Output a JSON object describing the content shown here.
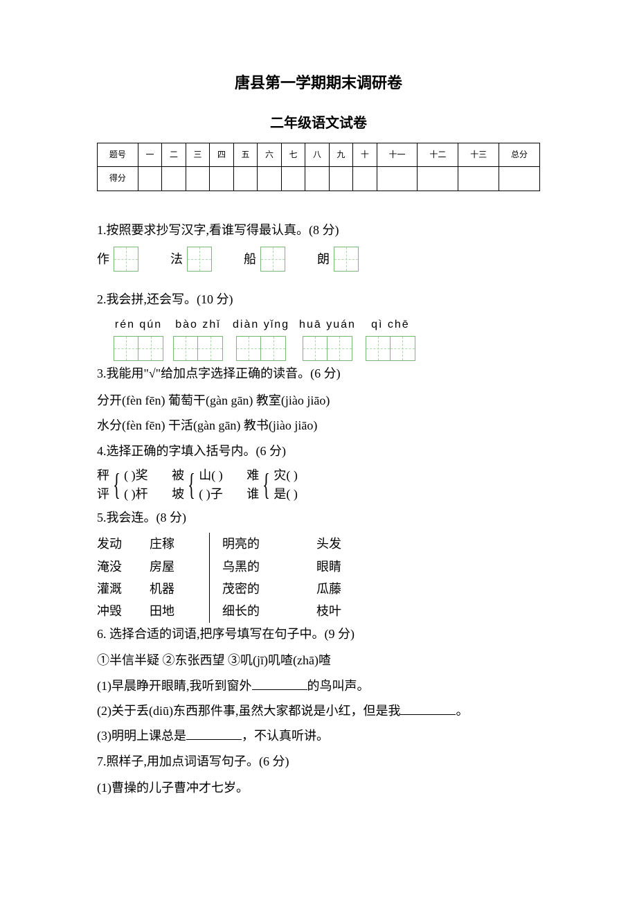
{
  "title_main": "唐县第一学期期末调研卷",
  "title_sub": "二年级语文试卷",
  "score_headers": [
    "题号",
    "一",
    "二",
    "三",
    "四",
    "五",
    "六",
    "七",
    "八",
    "九",
    "十",
    "十一",
    "十二",
    "十三",
    "总分"
  ],
  "score_row_label": "得分",
  "q1": {
    "text": "1.按照要求抄写汉字,看谁写得最认真。(8 分)",
    "chars": [
      "作",
      "法",
      "船",
      "朗"
    ]
  },
  "q2": {
    "text": "2.我会拼,还会写。(10  分)",
    "pinyin": [
      "rén    qún",
      "bào    zhǐ",
      "diàn    yǐng",
      "huā    yuán",
      "qì     chē"
    ]
  },
  "q3": {
    "text": "3.我能用\"√\"给加点字选择正确的读音。(6 分)",
    "lines": [
      "分开(fèn     fēn)       葡萄干(gàn     gān)      教室(jiào      jiāo)",
      "水分(fèn     fēn)      干活(gàn       gān)      教书(jiào      jiāo)"
    ]
  },
  "q4": {
    "text": "4.选择正确的字填入括号内。(6 分)",
    "group1": {
      "top": "秤",
      "bot": "评",
      "topright": "(      )奖",
      "botright": "(      )杆"
    },
    "group2": {
      "top": "被",
      "bot": "坡",
      "topright": "山(      )",
      "botright": "(      )子"
    },
    "group3": {
      "top": "难",
      "bot": "谁",
      "topright": "灾(       )",
      "botright": "是(      )"
    }
  },
  "q5": {
    "text": "5.我会连。(8 分)",
    "col1": [
      "发动",
      "淹没",
      "灌溉",
      "冲毁"
    ],
    "col2": [
      "庄稼",
      "房屋",
      "机器",
      "田地"
    ],
    "col3": [
      "明亮的",
      "乌黑的",
      "茂密的",
      "细长的"
    ],
    "col4": [
      "头发",
      "眼睛",
      "瓜藤",
      "枝叶"
    ]
  },
  "q6": {
    "text": "6.   选择合适的词语,把序号填写在句子中。(9 分)",
    "options": "①半信半疑        ②东张西望            ③叽(jī)叽喳(zhā)喳",
    "line1a": "(1)早晨睁开眼睛,我听到窗外",
    "line1b": "的鸟叫声。",
    "line2a": "(2)关于丢(diū)东西那件事,虽然大家都说是小红，但是我",
    "line2b": "。",
    "line3a": "(3)明明上课总是",
    "line3b": "，不认真听讲。"
  },
  "q7": {
    "text": "7.照样子,用加点词语写句子。(6  分)",
    "line1": "(1)曹操的儿子曹冲才七岁。"
  }
}
